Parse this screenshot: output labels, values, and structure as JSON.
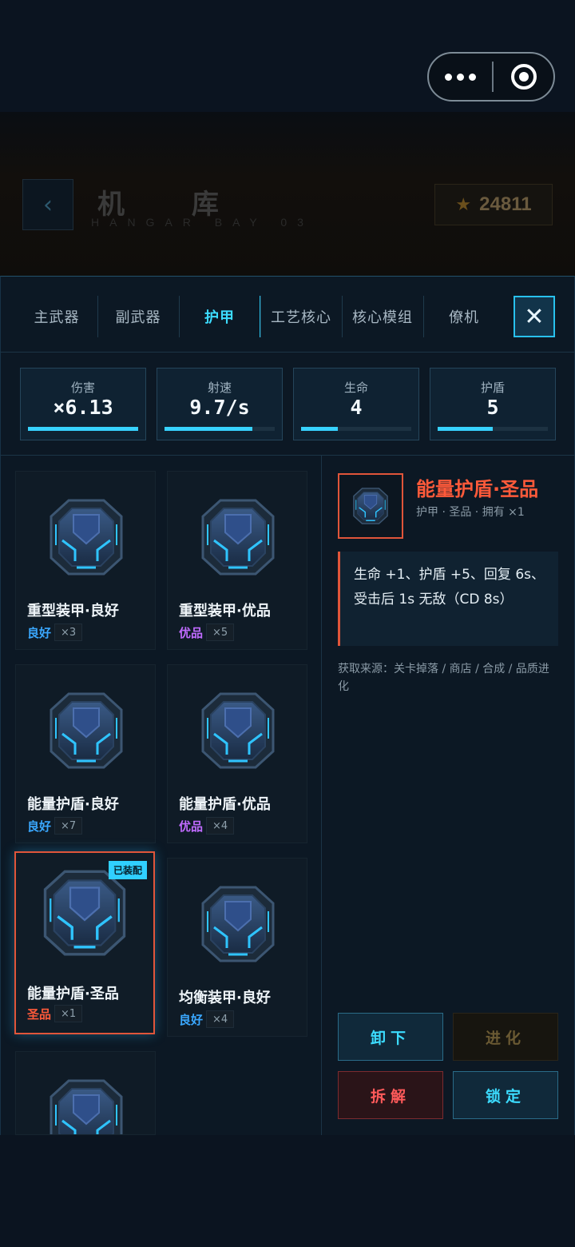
{
  "header": {
    "back_icon": "chevron-left-icon",
    "title": "机 库",
    "subtitle": "HANGAR BAY 03",
    "score": "24811"
  },
  "tabs": [
    {
      "label": "主武器",
      "active": false
    },
    {
      "label": "副武器",
      "active": false
    },
    {
      "label": "护甲",
      "active": true
    },
    {
      "label": "工艺核心",
      "active": false
    },
    {
      "label": "核心模组",
      "active": false
    },
    {
      "label": "僚机",
      "active": false
    }
  ],
  "stats": [
    {
      "label": "伤害",
      "value": "×6.13",
      "fill": 1.0
    },
    {
      "label": "射速",
      "value": "9.7/s",
      "fill": 0.8
    },
    {
      "label": "生命",
      "value": "4",
      "fill": 0.33
    },
    {
      "label": "护盾",
      "value": "5",
      "fill": 0.5
    }
  ],
  "items": [
    {
      "name": "重型装甲·良好",
      "quality": "良好",
      "count": "×3",
      "equipped": false
    },
    {
      "name": "重型装甲·优品",
      "quality": "优品",
      "count": "×5",
      "equipped": false
    },
    {
      "name": "能量护盾·良好",
      "quality": "良好",
      "count": "×7",
      "equipped": false
    },
    {
      "name": "能量护盾·优品",
      "quality": "优品",
      "count": "×4",
      "equipped": false
    },
    {
      "name": "能量护盾·圣品",
      "quality": "圣品",
      "count": "×1",
      "equipped": true
    },
    {
      "name": "均衡装甲·良好",
      "quality": "良好",
      "count": "×4",
      "equipped": false
    }
  ],
  "equipped_badge": "已装配",
  "colors": {
    "accent": "#37d2ff",
    "quality_good": "#3aa8ff",
    "quality_fine": "#c06bff",
    "quality_holy": "#ff5a3a"
  },
  "detail": {
    "title": "能量护盾·圣品",
    "tags": "护甲 · 圣品 · 拥有 ×1",
    "description": "生命 +1、护盾 +5、回复 6s、受击后 1s 无敌（CD 8s）",
    "source": "获取来源：关卡掉落 / 商店 / 合成 / 品质进化"
  },
  "actions": {
    "unequip": "卸下",
    "evolve": "进化",
    "dismantle": "拆解",
    "lock": "锁定"
  }
}
